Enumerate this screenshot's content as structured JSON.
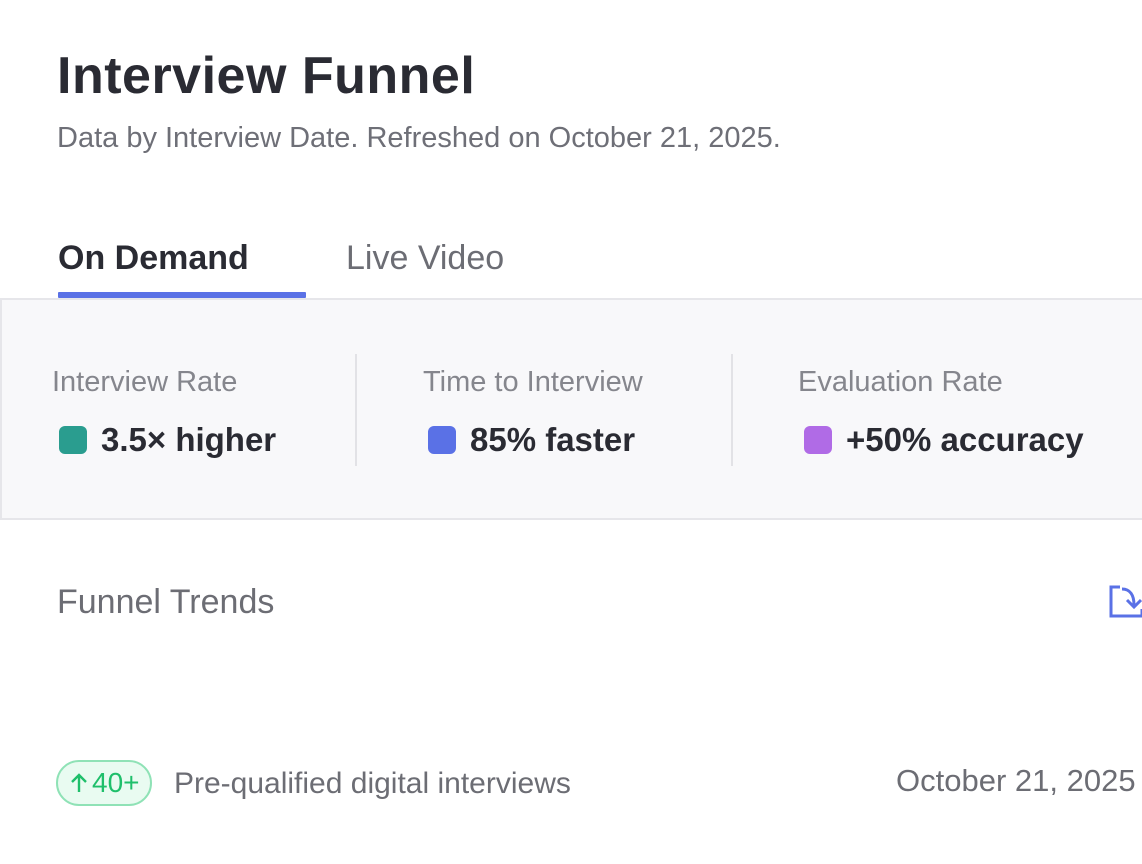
{
  "header": {
    "title": "Interview Funnel",
    "subtitle": "Data by Interview Date. Refreshed on October 21, 2025."
  },
  "tabs": [
    {
      "label": "On Demand",
      "active": true
    },
    {
      "label": "Live Video",
      "active": false
    }
  ],
  "stats": [
    {
      "label": "Interview Rate",
      "value": "3.5× higher",
      "color": "#2a9d8f"
    },
    {
      "label": "Time to Interview",
      "value": "85% faster",
      "color": "#5a71e6"
    },
    {
      "label": "Evaluation Rate",
      "value": "+50% accuracy",
      "color": "#b06be6"
    }
  ],
  "funnel_trends": {
    "title": "Funnel Trends",
    "export_icon": "export-download-icon",
    "items": [
      {
        "badge": "40+",
        "badge_icon": "arrow-up-icon",
        "label": "Pre-qualified digital interviews",
        "date": "October 21, 2025"
      }
    ]
  },
  "colors": {
    "accent": "#5a71e6",
    "positive": "#1fbf6b"
  }
}
